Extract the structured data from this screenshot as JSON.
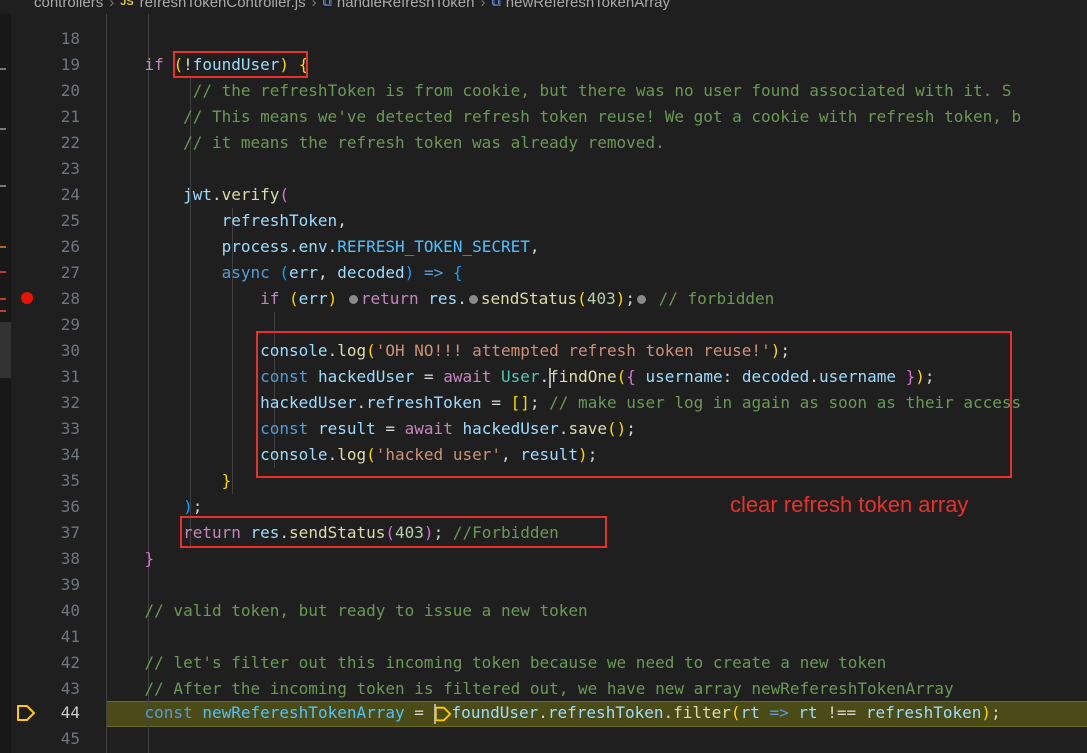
{
  "breadcrumb": {
    "folder": "controllers",
    "file_badge": "JS",
    "file": "refreshTokenController.js",
    "function": "handleRefreshToken",
    "variable": "newRefereshTokenArray"
  },
  "editor": {
    "line_numbers": [
      "18",
      "19",
      "20",
      "21",
      "22",
      "23",
      "24",
      "25",
      "26",
      "27",
      "28",
      "29",
      "30",
      "31",
      "32",
      "33",
      "34",
      "35",
      "36",
      "37",
      "38",
      "39",
      "40",
      "41",
      "42",
      "43",
      "44",
      "45"
    ],
    "active_line": "44",
    "breakpoint_line": "28",
    "code": {
      "l20_comment": "// the refreshToken is from cookie, but there was no user found associated with it. S",
      "l21_comment": "// This means we've detected refresh token reuse! We got a cookie with refresh token, b",
      "l22_comment": "// it means the refresh token was already removed.",
      "l28_comment": "// forbidden",
      "l30_string": "'OH NO!!! attempted refresh token reuse!'",
      "l32_comment": "// make user log in again as soon as their access",
      "l34_string": "'hacked user'",
      "l37_comment": "//Forbidden",
      "l40_comment": "// valid token, but ready to issue a new token",
      "l42_comment": "// let's filter out this incoming token because we need to create a new token",
      "l43_comment": "// After the incoming token is filtered out, we have new array newRefereshTokenArray",
      "num_403": "403",
      "secret": "REFRESH_TOKEN_SECRET"
    }
  },
  "annotation": {
    "text": "clear refresh token array",
    "color": "#e8312b"
  },
  "colors": {
    "background": "#1f1f1f",
    "keyword": "#569cd6",
    "control": "#c586c0",
    "variable": "#9cdcfe",
    "function": "#dcdcaa",
    "string": "#ce9178",
    "comment": "#6a9955",
    "number": "#b5cea8",
    "highlight_line": "#4b4b18"
  },
  "icons": {
    "breakpoint": "breakpoint-dot-icon",
    "debug_pointer": "debug-arrow-icon",
    "symbol": "symbol-variable-icon"
  }
}
